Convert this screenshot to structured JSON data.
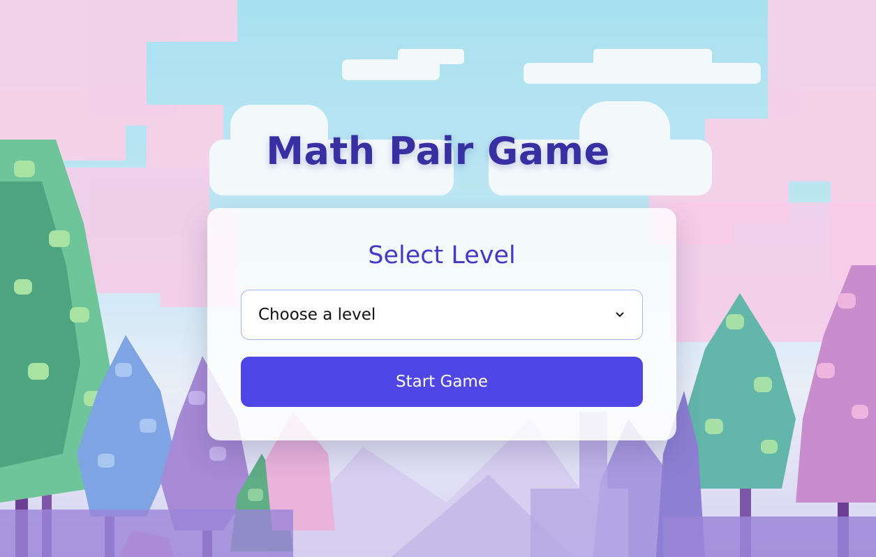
{
  "game": {
    "title": "Math Pair Game"
  },
  "level_panel": {
    "heading": "Select Level",
    "select_value": "Choose a level",
    "start_label": "Start Game"
  },
  "colors": {
    "title": "#3730a3",
    "heading": "#4338ca",
    "button": "#4f46e5",
    "sky": "#a9e1f0",
    "blossom": "#f7c8e8"
  },
  "icons": {
    "select_arrow": "chevron-down-icon"
  }
}
